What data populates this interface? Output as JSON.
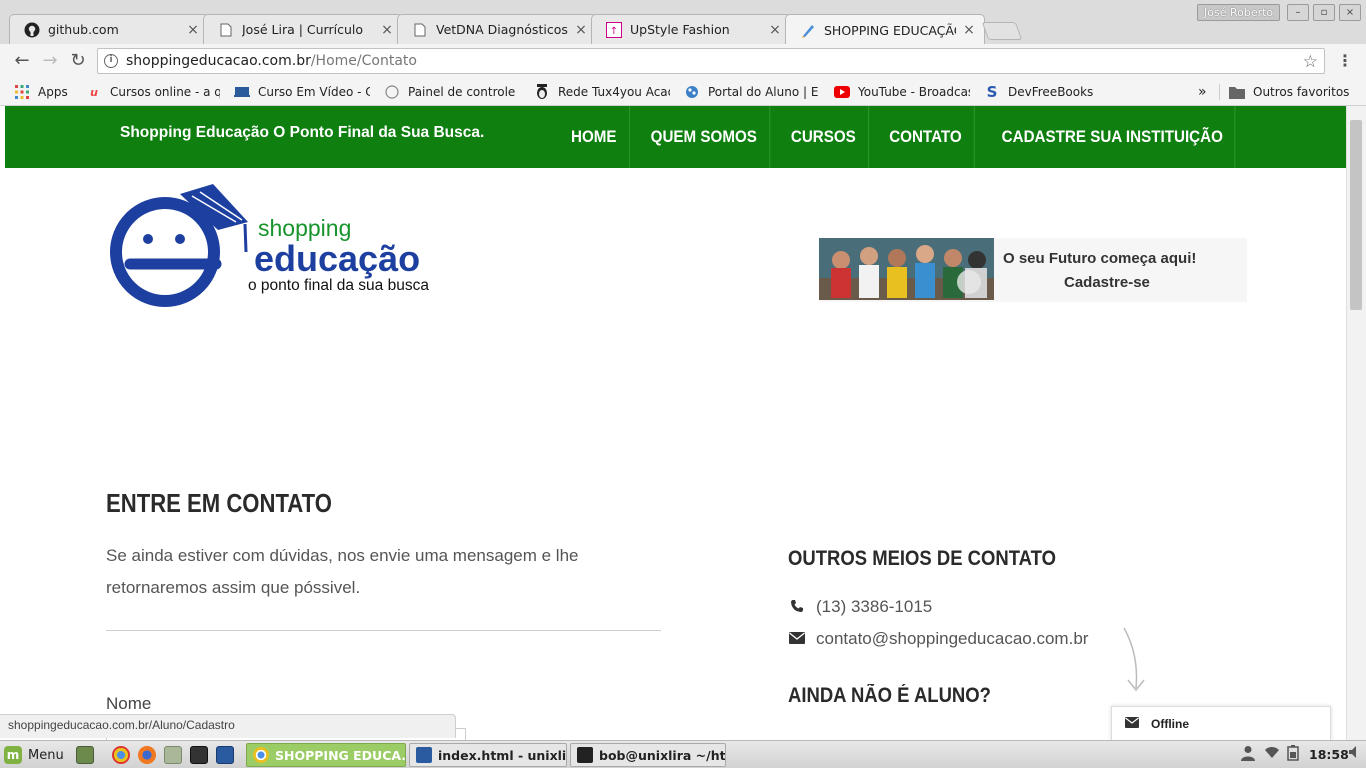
{
  "browser": {
    "tabs": [
      {
        "title": "github.com",
        "icon": "github-icon"
      },
      {
        "title": "José Lira | Currículo",
        "icon": "page-icon"
      },
      {
        "title": "VetDNA Diagnósticos M",
        "icon": "page-icon"
      },
      {
        "title": "UpStyle Fashion",
        "icon": "upstyle-icon"
      },
      {
        "title": "SHOPPING EDUCAÇÃO",
        "icon": "shopping-icon"
      }
    ],
    "profile_name": "José Roberto",
    "url_host": "shoppingeducacao.com.br",
    "url_path": "/Home/Contato",
    "bookmarks": [
      {
        "label": "Apps"
      },
      {
        "label": "Cursos online - a qu"
      },
      {
        "label": "Curso Em Vídeo - Cu"
      },
      {
        "label": "Painel de controle |"
      },
      {
        "label": "Rede Tux4you Acad"
      },
      {
        "label": "Portal do Aluno | E"
      },
      {
        "label": "YouTube - Broadcas"
      },
      {
        "label": "DevFreeBooks"
      }
    ],
    "bookmarks_overflow": "»",
    "other_bookmarks": "Outros favoritos",
    "status_url": "shoppingeducacao.com.br/Aluno/Cadastro"
  },
  "site": {
    "tagline": "Shopping Educação O Ponto Final da Sua Busca.",
    "menu": [
      "HOME",
      "QUEM SOMOS",
      "CURSOS",
      "CONTATO",
      "CADASTRE SUA INSTITUIÇÃO"
    ],
    "logo": {
      "top": "shopping",
      "main": "educação",
      "sub": "o ponto final da sua busca"
    },
    "banner": {
      "line1": "O seu Futuro começa aqui!",
      "line2": "Cadastre-se"
    },
    "contact_title": "ENTRE EM CONTATO",
    "contact_desc": "Se ainda estiver com dúvidas, nos envie uma mensagem e lhe retornaremos assim que póssivel.",
    "form_label_nome": "Nome",
    "other_title": "OUTROS MEIOS DE CONTATO",
    "phone": "(13) 3386-1015",
    "email": "contato@shoppingeducacao.com.br",
    "aluno_title": "AINDA NÃO É ALUNO?",
    "chat_status": "Offline",
    "colors": {
      "nav_green": "#0f8010",
      "logo_blue": "#1c3fa0",
      "logo_green": "#17942c"
    }
  },
  "taskbar": {
    "menu_label": "Menu",
    "tasks": [
      {
        "label": "SHOPPING EDUCA...",
        "active": true
      },
      {
        "label": "index.html - unixli...",
        "active": false
      },
      {
        "label": "bob@unixlira ~/ht...",
        "active": false
      }
    ],
    "clock": "18:58"
  }
}
